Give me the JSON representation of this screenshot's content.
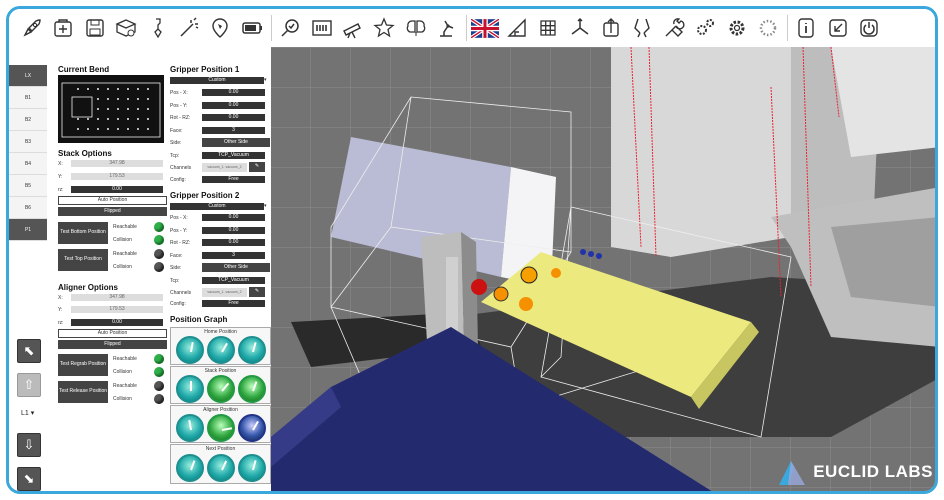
{
  "toolbar": {
    "icons": [
      "rocket-icon",
      "new-file-icon",
      "save-icon",
      "settings-icon",
      "tool-icon",
      "magic-wand-icon",
      "compass-icon",
      "battery-icon",
      "zoom-icon",
      "film-icon",
      "telescope-icon",
      "star-gear-icon",
      "brain-icon",
      "robot-arm-icon",
      "uk-flag-icon",
      "triangle-icon",
      "grid-icon",
      "axis-icon",
      "export-icon",
      "gripper-icon",
      "tools-icon",
      "gears-icon",
      "gear-icon",
      "loading-icon",
      "info-icon",
      "collapse-icon",
      "power-icon"
    ]
  },
  "tabs": [
    "LX",
    "B1",
    "B2",
    "B3",
    "B4",
    "B5",
    "B6",
    "P1"
  ],
  "level": {
    "value": "L1",
    "arrow": "▾"
  },
  "current_bend": {
    "title": "Current Bend"
  },
  "stack": {
    "title": "Stack Options",
    "x_label": "X:",
    "x": "347.98",
    "y_label": "Y:",
    "y": "179.53",
    "rz_label": "rz:",
    "rz": "0.00",
    "auto": "Auto Position",
    "flipped": "Flipped",
    "test_bottom": "Test Bottom Position",
    "test_top": "Test Top Position",
    "reachable": "Reachable",
    "collision": "Collision"
  },
  "aligner": {
    "title": "Aligner Options",
    "x_label": "X:",
    "x": "347.98",
    "y_label": "Y:",
    "y": "179.53",
    "rz_label": "rz:",
    "rz": "0.00",
    "auto": "Auto Position",
    "flipped": "Flipped",
    "test_regrab": "Test Regrab Position",
    "test_release": "Test Release Position",
    "reachable": "Reachable",
    "collision": "Collision"
  },
  "gripper1": {
    "title": "Gripper Position 1",
    "mode": "Custom",
    "pos_x_label": "Pos - X:",
    "pos_x": "0.00",
    "pos_y_label": "Pos - Y:",
    "pos_y": "0.00",
    "rot_label": "Rot - RZ:",
    "rot": "0.00",
    "face_label": "Face:",
    "face": "3",
    "side_label": "Side:",
    "side": "Other Side",
    "tcp_label": "Tcp:",
    "tcp": "TCP_Vacuum",
    "channels_label": "Channels",
    "channels": "vacuum_1, vacuum_2",
    "config_label": "Config:",
    "config": "Free"
  },
  "gripper2": {
    "title": "Gripper Position 2",
    "mode": "Custom",
    "pos_x_label": "Pos - X:",
    "pos_x": "0.00",
    "pos_y_label": "Pos - Y:",
    "pos_y": "0.00",
    "rot_label": "Rot - RZ:",
    "rot": "0.00",
    "face_label": "Face:",
    "face": "3",
    "side_label": "Side:",
    "side": "Other Side",
    "tcp_label": "Tcp:",
    "tcp": "TCP_Vacuum",
    "channels_label": "Channels",
    "channels": "vacuum_1, vacuum_2",
    "config_label": "Config:",
    "config": "Free"
  },
  "graph": {
    "title": "Position Graph",
    "home": "Home Position",
    "stack": "Stack Position",
    "aligner": "Aligner Position",
    "next": "Next Position"
  },
  "brand": {
    "name": "EUCLID LABS",
    "accent": "#3aa7dd"
  }
}
